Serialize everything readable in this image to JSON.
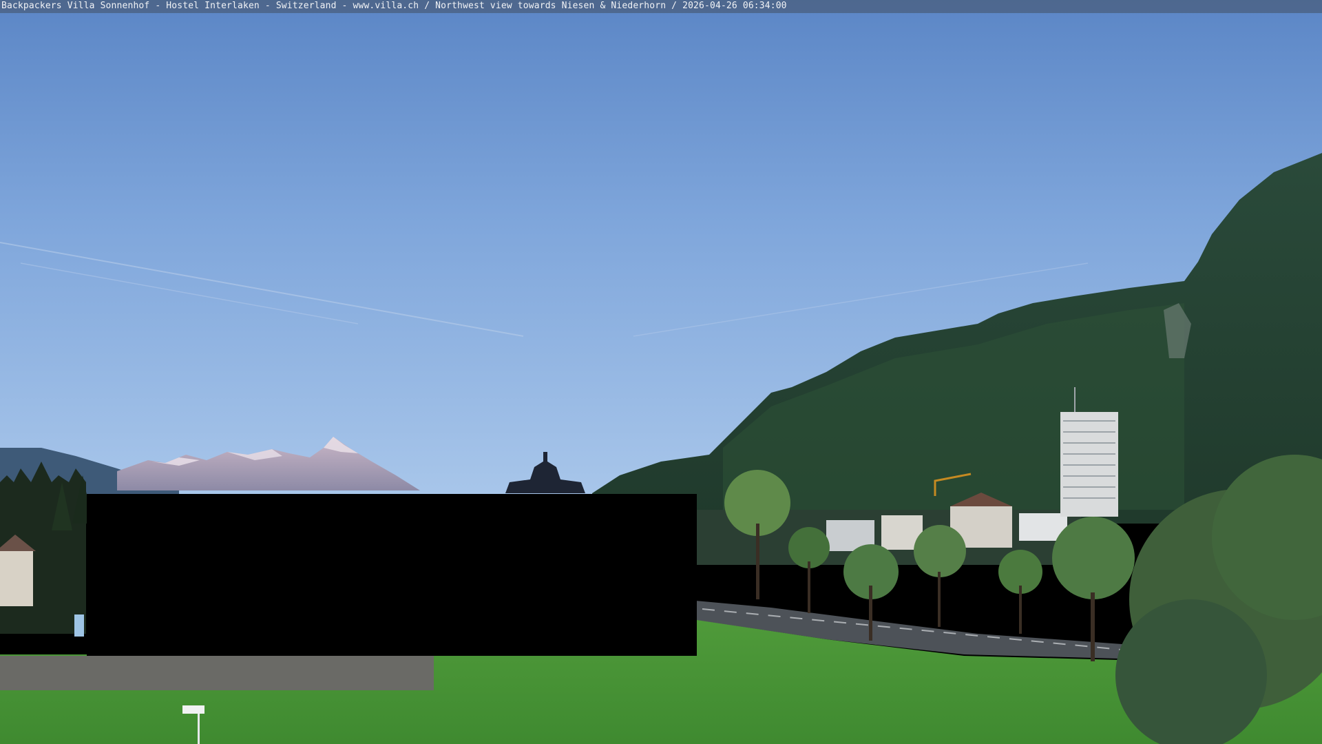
{
  "webcam": {
    "caption": "Backpackers Villa Sonnenhof - Hostel Interlaken - Switzerland - www.villa.ch / Northwest view towards Niesen & Niederhorn / 2026-04-26 06:34:00"
  },
  "colors": {
    "sky_top": "#5b86c6",
    "sky_horizon": "#a8c6ea",
    "forest_dark": "#1f3a2a",
    "forest_mid": "#2e5236",
    "meadow": "#4f9a3a",
    "road": "#4d5258",
    "redaction": "#000000",
    "caption_bar": "#46556e"
  }
}
